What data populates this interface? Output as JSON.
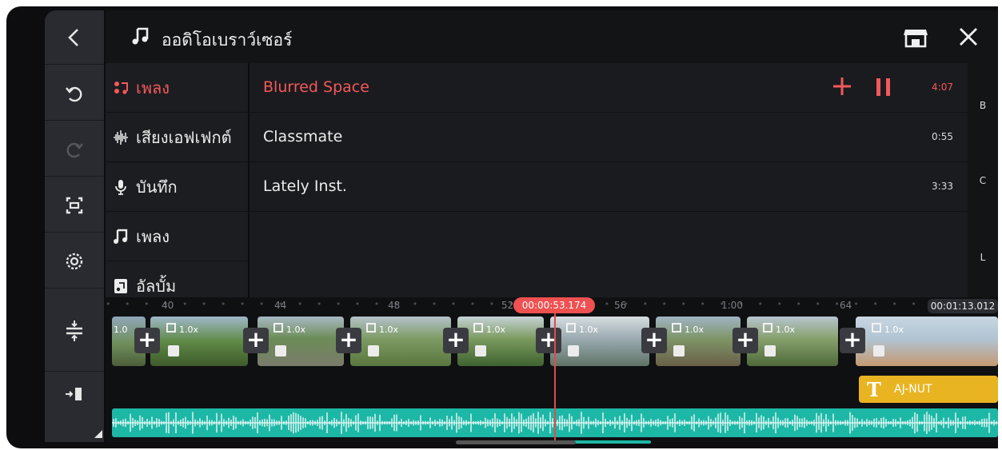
{
  "header": {
    "title": "ออดิโอเบราว์เซอร์"
  },
  "colors": {
    "accent": "#f3585a",
    "audio_track": "#1db7a6",
    "text_track": "#e8b422",
    "playhead": "#e24b4b"
  },
  "categories": [
    {
      "label": "เพลง",
      "icon": "music-group-icon",
      "active": true
    },
    {
      "label": "เสียงเอฟเฟกต์",
      "icon": "waveform-icon",
      "active": false
    },
    {
      "label": "บันทึก",
      "icon": "microphone-icon",
      "active": false
    },
    {
      "label": "เพลง",
      "icon": "music-note-icon",
      "active": false
    },
    {
      "label": "อัลบั้ม",
      "icon": "album-icon",
      "active": false
    }
  ],
  "tracks": [
    {
      "name": "Blurred Space",
      "duration": "4:07",
      "active": true
    },
    {
      "name": "Classmate",
      "duration": "0:55",
      "active": false
    },
    {
      "name": "Lately Inst.",
      "duration": "3:33",
      "active": false
    }
  ],
  "alpha_index": [
    "B",
    "C",
    "L"
  ],
  "timeline": {
    "ruler_ticks": [
      "40",
      "44",
      "48",
      "52",
      "56",
      "1:00",
      "64"
    ],
    "playhead_time": "00:00:53.174",
    "end_time": "00:01:13.012",
    "clip_speed_labels": [
      "1.0",
      "1.0x",
      "1.0x",
      "1.0x",
      "1.0x",
      "1.0x",
      "1.0x",
      "1.0x",
      "1.0x"
    ],
    "text_layer_label": "AJ-NUT"
  }
}
